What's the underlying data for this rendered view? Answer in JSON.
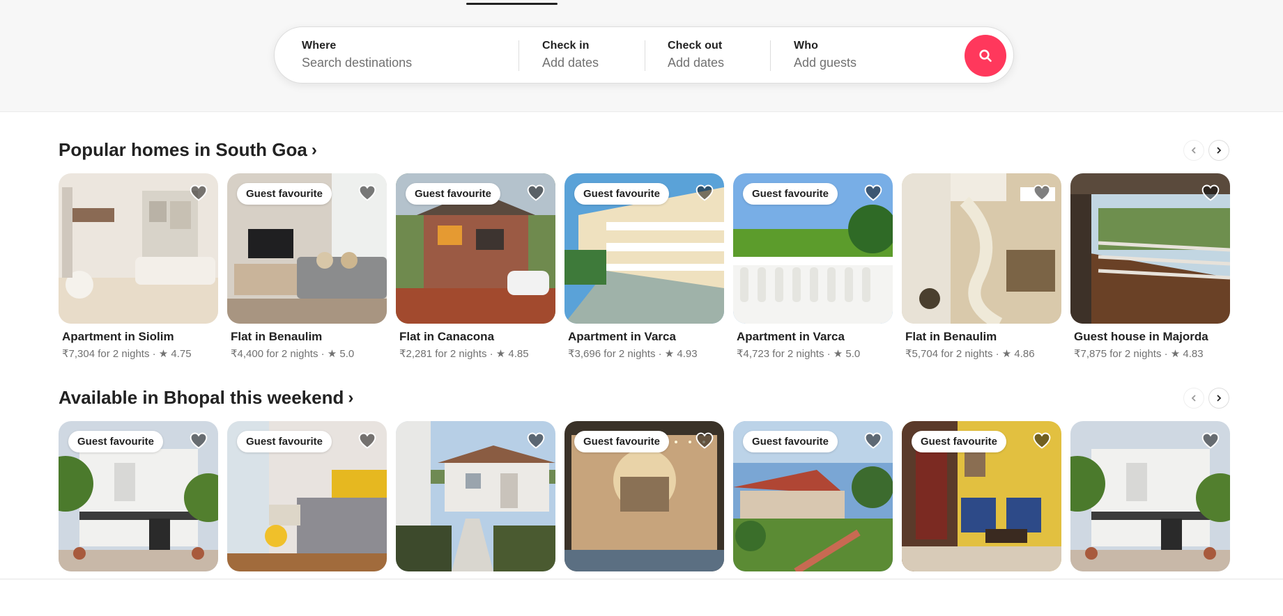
{
  "search": {
    "where_label": "Where",
    "where_placeholder": "Search destinations",
    "checkin_label": "Check in",
    "checkin_value": "Add dates",
    "checkout_label": "Check out",
    "checkout_value": "Add dates",
    "who_label": "Who",
    "who_value": "Add guests"
  },
  "sections": [
    {
      "title": "Popular homes in South Goa",
      "listings": [
        {
          "name": "Apartment in Siolim",
          "meta": "₹7,304 for 2 nights · ★ 4.75",
          "badge": "",
          "scene": "interior-white"
        },
        {
          "name": "Flat in Benaulim",
          "meta": "₹4,400 for 2 nights · ★ 5.0",
          "badge": "Guest favourite",
          "scene": "interior-living"
        },
        {
          "name": "Flat in Canacona",
          "meta": "₹2,281 for 2 nights · ★ 4.85",
          "badge": "Guest favourite",
          "scene": "house-brick"
        },
        {
          "name": "Apartment in Varca",
          "meta": "₹3,696 for 2 nights · ★ 4.93",
          "badge": "Guest favourite",
          "scene": "apartment-block"
        },
        {
          "name": "Apartment in Varca",
          "meta": "₹4,723 for 2 nights · ★ 5.0",
          "badge": "Guest favourite",
          "scene": "balcony-field"
        },
        {
          "name": "Flat in Benaulim",
          "meta": "₹5,704 for 2 nights · ★ 4.86",
          "badge": "",
          "scene": "interior-stairs"
        },
        {
          "name": "Guest house in Majorda",
          "meta": "₹7,875 for 2 nights · ★ 4.83",
          "badge": "",
          "scene": "veranda"
        }
      ]
    },
    {
      "title": "Available in Bhopal this weekend",
      "listings": [
        {
          "name": "",
          "meta": "",
          "badge": "Guest favourite",
          "scene": "house-white"
        },
        {
          "name": "",
          "meta": "",
          "badge": "Guest favourite",
          "scene": "bedroom-yellow"
        },
        {
          "name": "",
          "meta": "",
          "badge": "",
          "scene": "cottage"
        },
        {
          "name": "",
          "meta": "",
          "badge": "Guest favourite",
          "scene": "palace-lights"
        },
        {
          "name": "",
          "meta": "",
          "badge": "Guest favourite",
          "scene": "resort-garden"
        },
        {
          "name": "",
          "meta": "",
          "badge": "Guest favourite",
          "scene": "room-blue-chairs"
        },
        {
          "name": "",
          "meta": "",
          "badge": "",
          "scene": "house-white"
        }
      ]
    }
  ],
  "icons": {
    "search": "search-icon",
    "heart": "heart-icon",
    "prev": "chevron-left-icon",
    "next": "chevron-right-icon"
  },
  "colors": {
    "brand": "#ff385c",
    "text": "#222222",
    "muted": "#717171"
  }
}
